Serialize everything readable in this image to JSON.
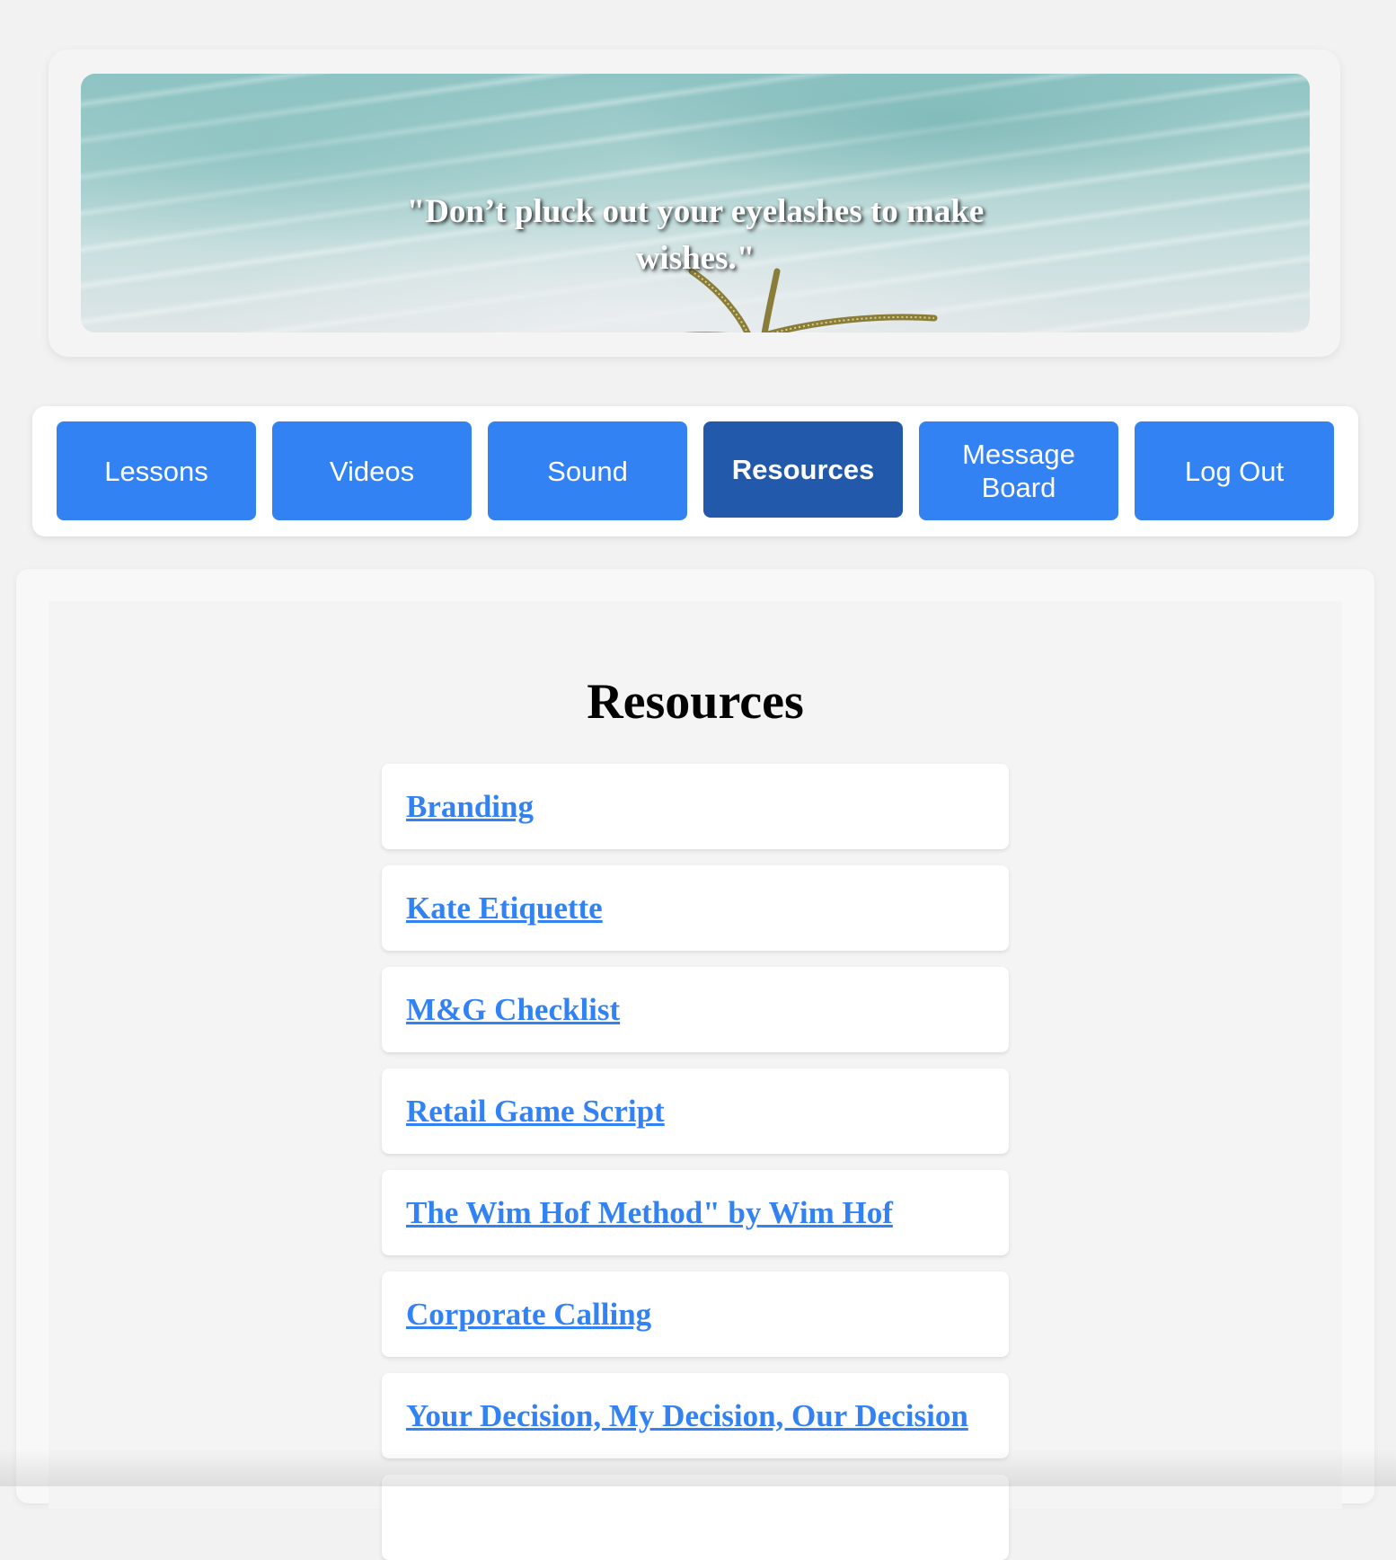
{
  "header": {
    "quote": "\"Don’t pluck out your eyelashes to make wishes.\""
  },
  "nav": {
    "items": [
      {
        "label": "Lessons",
        "active": false
      },
      {
        "label": "Videos",
        "active": false
      },
      {
        "label": "Sound",
        "active": false
      },
      {
        "label": "Resources",
        "active": true
      },
      {
        "label": "Message Board",
        "active": false
      },
      {
        "label": "Log Out",
        "active": false
      }
    ]
  },
  "main": {
    "title": "Resources",
    "resources": [
      {
        "label": "Branding"
      },
      {
        "label": "Kate Etiquette"
      },
      {
        "label": "M&G Checklist"
      },
      {
        "label": "Retail Game Script"
      },
      {
        "label": "The Wim Hof Method\"  by Wim Hof"
      },
      {
        "label": "Corporate Calling"
      },
      {
        "label": "Your Decision, My Decision, Our Decision"
      }
    ]
  },
  "colors": {
    "nav_button": "#3382f4",
    "nav_button_active": "#2359ab",
    "link": "#3382f4",
    "page_background": "#f2f2f2"
  }
}
